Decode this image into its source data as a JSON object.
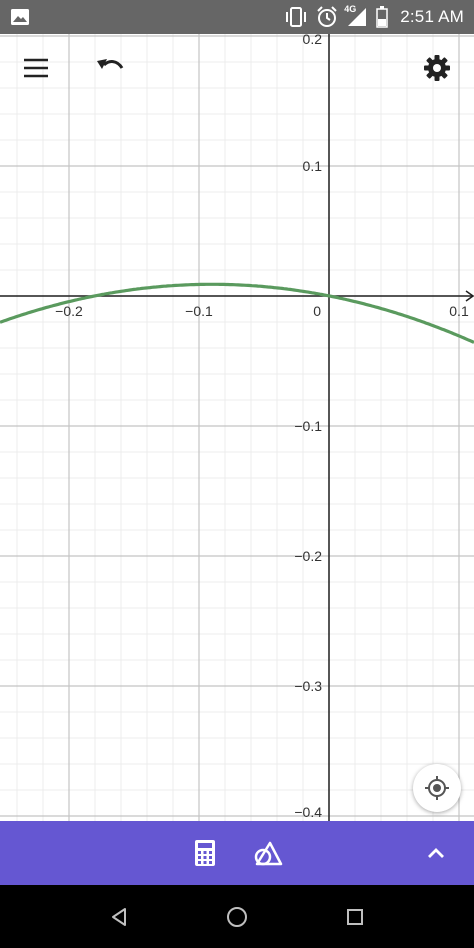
{
  "status_bar": {
    "time": "2:51 AM",
    "network": "4G",
    "icons": [
      "image-icon",
      "vibrate-icon",
      "alarm-icon",
      "signal-icon",
      "battery-icon"
    ]
  },
  "toolbar_top": {
    "icons": [
      "menu-icon",
      "undo-icon",
      "settings-icon"
    ]
  },
  "graph": {
    "x_tick_labels": [
      {
        "value": -0.2,
        "label": "−0.2"
      },
      {
        "value": -0.1,
        "label": "−0.1"
      },
      {
        "value": 0,
        "label": "0"
      },
      {
        "value": 0.1,
        "label": "0.1"
      }
    ],
    "y_tick_labels": [
      {
        "value": 0.2,
        "label": "0.2"
      },
      {
        "value": 0.1,
        "label": "0.1"
      },
      {
        "value": -0.1,
        "label": "−0.1"
      },
      {
        "value": -0.2,
        "label": "−0.2"
      },
      {
        "value": -0.3,
        "label": "−0.3"
      },
      {
        "value": -0.4,
        "label": "−0.4"
      }
    ],
    "curve_color": "#5a9a5e",
    "curve": {
      "vertex_x": -0.09,
      "vertex_y": 0.009,
      "a": -1.1
    }
  },
  "bottom_toolbar": {
    "color": "#6557d2",
    "icons": [
      "calculator-icon",
      "geometry-tools-icon",
      "chevron-up-icon"
    ]
  },
  "nav_bar": {
    "icons": [
      "back-icon",
      "home-icon",
      "recents-icon"
    ]
  }
}
